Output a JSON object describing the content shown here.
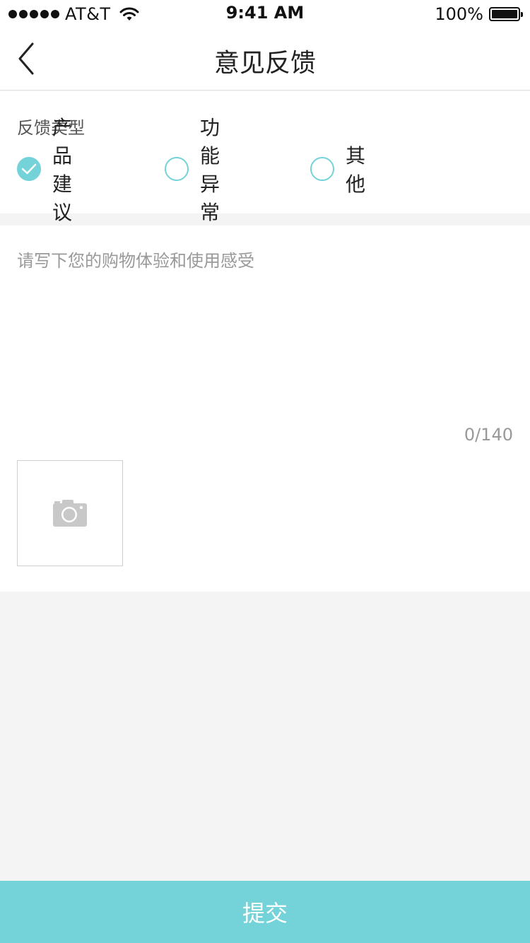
{
  "status_bar": {
    "carrier": "AT&T",
    "time": "9:41 AM",
    "battery": "100%",
    "battery_level": 1.0,
    "signal_icon": "signal-dots-icon",
    "wifi_icon": "wifi-icon"
  },
  "nav": {
    "title": "意见反馈",
    "back_icon": "chevron-left-icon"
  },
  "feedback_type": {
    "label": "反馈类型",
    "options": [
      {
        "label": "产品建议",
        "checked": true
      },
      {
        "label": "功能异常",
        "checked": false
      },
      {
        "label": "其他",
        "checked": false
      }
    ]
  },
  "feedback_text": {
    "placeholder": "请写下您的购物体验和使用感受",
    "value": "",
    "counter": "0/140"
  },
  "photo": {
    "icon": "camera-icon"
  },
  "submit": {
    "label": "提交"
  },
  "colors": {
    "accent": "#73d3d8",
    "background": "#f4f4f4",
    "surface": "#ffffff",
    "placeholder": "#999999"
  }
}
